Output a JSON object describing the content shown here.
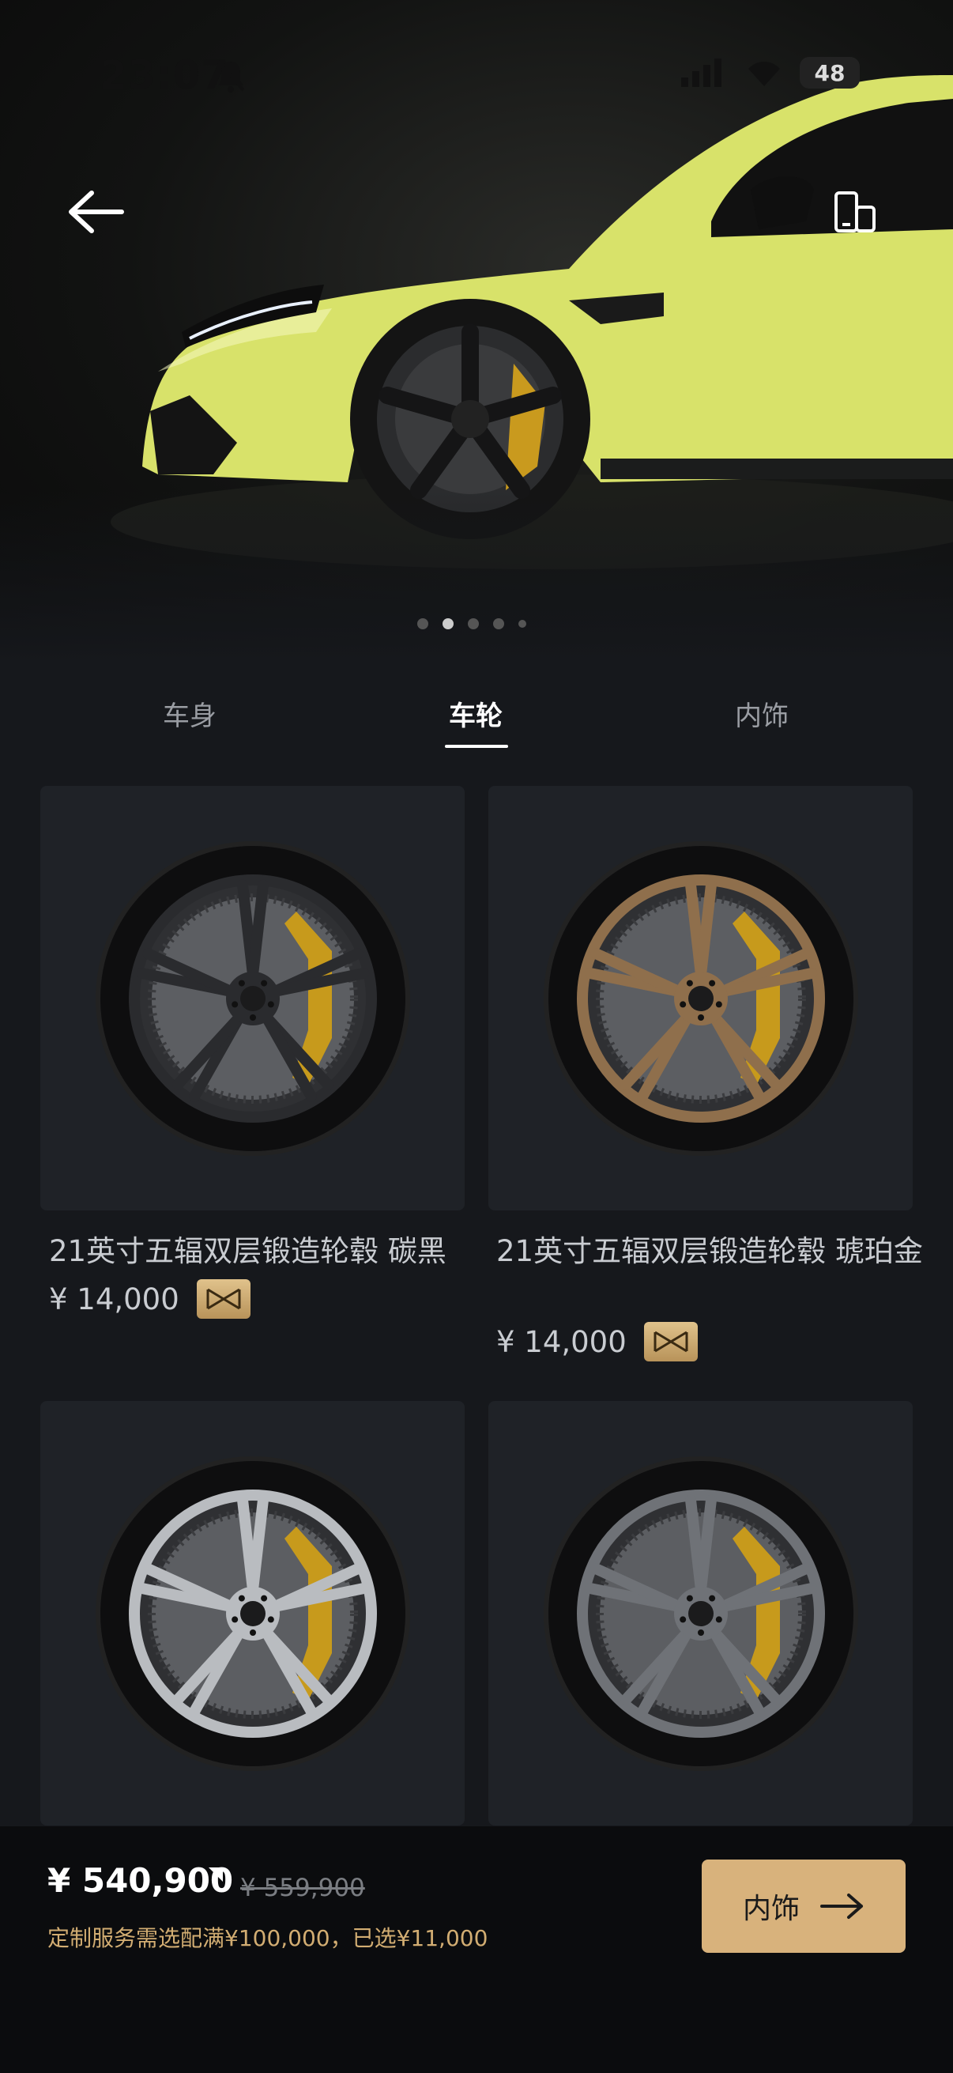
{
  "status_bar": {
    "time": "23:07",
    "battery": "48",
    "icons": [
      "bell-off-icon",
      "signal-icon",
      "wifi-icon",
      "battery-icon"
    ]
  },
  "hero": {
    "car_color": "#d8e26a",
    "carousel_page": 2,
    "carousel_count": 5
  },
  "tabs": [
    {
      "label": "车身",
      "active": false
    },
    {
      "label": "车轮",
      "active": true
    },
    {
      "label": "内饰",
      "active": false
    }
  ],
  "wheels": [
    {
      "title": "21英寸五辐双层锻造轮毂 碳黑",
      "price": "¥ 14,000",
      "finish": "#2a2b2e"
    },
    {
      "title": "21英寸五辐双层锻造轮毂 琥珀金",
      "price": "¥ 14,000",
      "finish": "#8f6f4c"
    },
    {
      "title": "",
      "price": "",
      "finish": "#b9bcc0"
    },
    {
      "title": "",
      "price": "",
      "finish": "#6f7277"
    }
  ],
  "bottom": {
    "price": "¥ 540,900",
    "old_price": "¥ 559,900",
    "note": "定制服务需选配满¥100,000，已选¥11,000",
    "next_label": "内饰"
  },
  "colors": {
    "accent_gold": "#d8b27c",
    "background": "#16181c",
    "card": "#1f2227"
  }
}
